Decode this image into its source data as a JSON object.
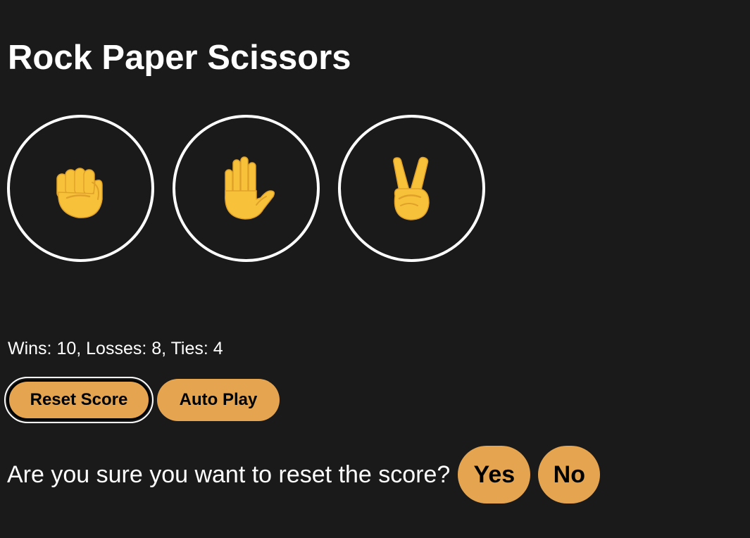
{
  "page": {
    "title": "Rock Paper Scissors"
  },
  "moves": [
    {
      "name": "rock",
      "icon": "raised-fist-icon"
    },
    {
      "name": "paper",
      "icon": "raised-hand-icon"
    },
    {
      "name": "scissors",
      "icon": "victory-hand-icon"
    }
  ],
  "score": {
    "text": "Wins: 10, Losses: 8, Ties: 4",
    "wins": 10,
    "losses": 8,
    "ties": 4
  },
  "controls": {
    "reset_label": "Reset Score",
    "auto_play_label": "Auto Play"
  },
  "confirm": {
    "question": "Are you sure you want to reset the score?",
    "yes_label": "Yes",
    "no_label": "No"
  },
  "colors": {
    "background": "#1a1a1a",
    "text": "#ffffff",
    "button_fill": "#e5a44f",
    "emoji_skin": "#f7c23a"
  }
}
